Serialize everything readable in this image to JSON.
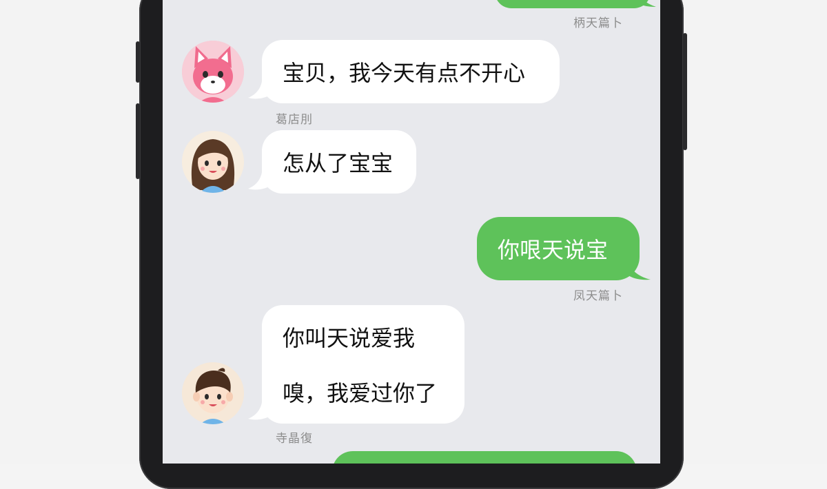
{
  "messages": [
    {
      "id": "m0",
      "direction": "outgoing",
      "text": "",
      "time": "柄天篇卜"
    },
    {
      "id": "m1",
      "direction": "incoming",
      "avatar": "pink-cat-avatar",
      "text": "宝贝，我今天有点不开心",
      "time": "葛店刖"
    },
    {
      "id": "m2",
      "direction": "incoming",
      "avatar": "girl-avatar",
      "text": "怎从了宝宝",
      "time": ""
    },
    {
      "id": "m3",
      "direction": "outgoing",
      "text": "你哏天说宝",
      "time": "凤天篇卜"
    },
    {
      "id": "m4",
      "direction": "incoming",
      "avatar": "boy-avatar",
      "lines": [
        "你叫天说爱我",
        "嗅，我爱过你了"
      ],
      "time": "寺晶復"
    },
    {
      "id": "m5",
      "direction": "outgoing",
      "text": "",
      "time": ""
    }
  ],
  "colors": {
    "outgoing_bubble": "#5ec25a",
    "incoming_bubble": "#ffffff",
    "chat_background": "#e8e9ed",
    "phone_frame": "#1d1d1f",
    "timestamp": "#8c8c8c"
  }
}
